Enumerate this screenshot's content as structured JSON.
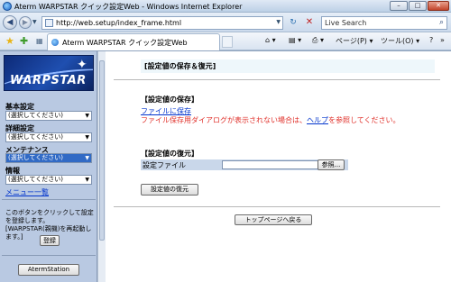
{
  "window": {
    "title": "Aterm WARPSTAR クイック設定Web - Windows Internet Explorer",
    "min": "–",
    "max": "□",
    "close": "✕"
  },
  "address_bar": {
    "back": "◀",
    "forward": "▶",
    "url": "http://web.setup/index_frame.html",
    "refresh": "↻",
    "stop": "✕"
  },
  "search": {
    "placeholder": "Live Search",
    "icon": "search-icon"
  },
  "tab": {
    "label": "Aterm WARPSTAR クイック設定Web"
  },
  "commands": {
    "home": "⌂ ▾",
    "feeds": "▤ ▾",
    "print": "⎙ ▾",
    "page": "ページ(P) ▾",
    "tools": "ツール(O) ▾",
    "help": "?",
    "more": "»"
  },
  "sidebar": {
    "logo_text": "WARPSTAR",
    "groups": [
      {
        "label": "基本設定",
        "selected": "(選択してください)"
      },
      {
        "label": "詳細設定",
        "selected": "(選択してください)"
      },
      {
        "label": "メンテナンス",
        "selected": "(選択してください)"
      },
      {
        "label": "情報",
        "selected": "(選択してください)"
      }
    ],
    "menu_list": "メニュー一覧",
    "register_note": "このボタンをクリックして設定を登録します。[WARPSTAR(親機)を再起動します。]",
    "register_button": "登録",
    "station_button": "AtermStation"
  },
  "main": {
    "title": "[設定値の保存＆復元]",
    "save_heading": "【設定値の保存】",
    "save_link": "ファイルに保存",
    "warn_prefix": "ファイル保存用ダイアログが表示されない場合は、",
    "warn_link": "ヘルプ",
    "warn_suffix": "を参照してください。",
    "restore_heading": "【設定値の復元】",
    "file_label": "設定ファイル",
    "browse_button": "参照...",
    "restore_button": "設定値の復元",
    "top_button": "トップページへ戻る"
  }
}
